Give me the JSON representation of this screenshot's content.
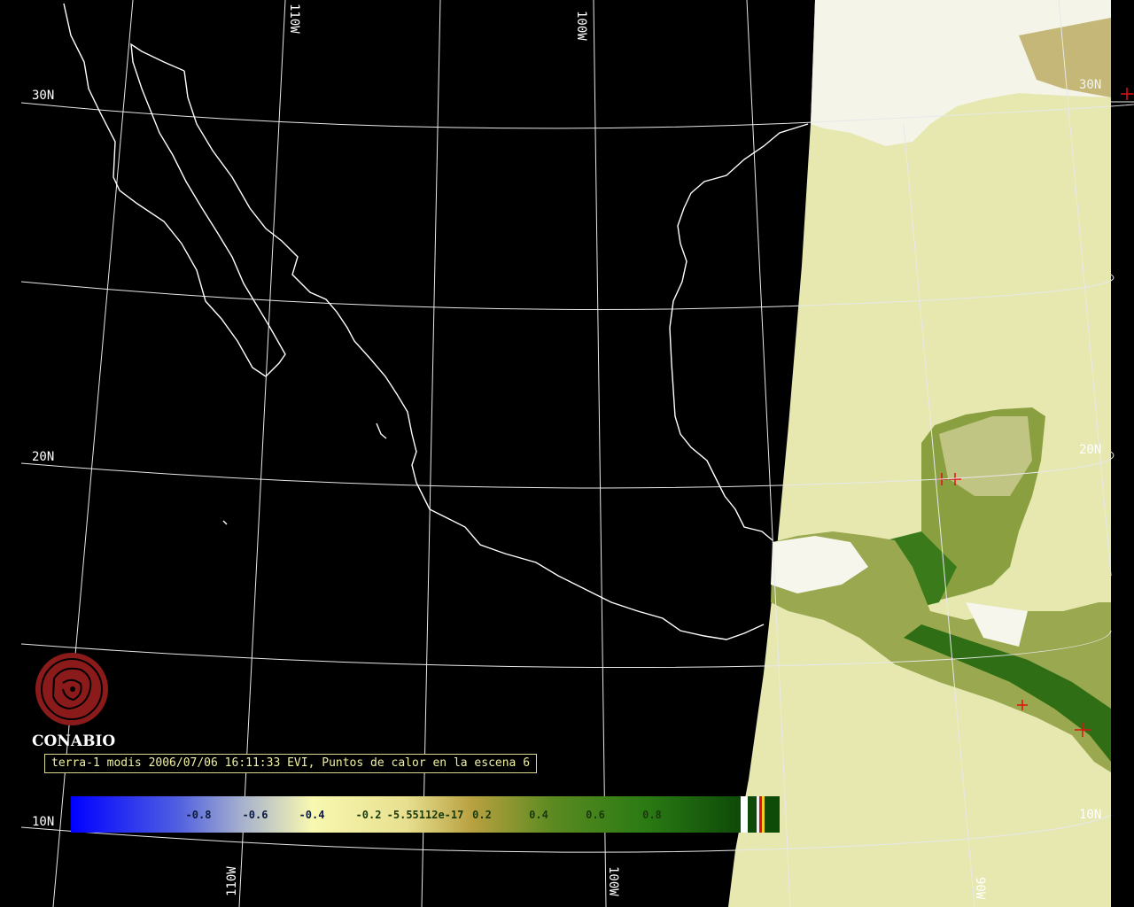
{
  "map": {
    "grid_labels": {
      "lat_30n": "30N",
      "lat_20n_left": "20N",
      "lat_10n_left": "10N",
      "lat_20n_right": "20N",
      "lat_10n_right": "10N",
      "lat_30n_right": "30N",
      "lon_110w_top": "110W",
      "lon_100w_top": "100W",
      "lon_110w_bottom": "110W",
      "lon_100w_bottom": "100W",
      "lon_90w_bottom": "90W"
    },
    "colors": {
      "background": "#000000",
      "coastline": "#ffffff",
      "graticule": "#e8e8e8",
      "water": "#e6e8b0",
      "vegetation_dark": "#2e6e14",
      "vegetation_light": "#b8a85a",
      "cloud": "#ffffff",
      "hotspot": "#e01010"
    }
  },
  "logo": {
    "name": "CONABIO",
    "color": "#8b1a1a"
  },
  "caption": {
    "text": "terra-1 modis 2006/07/06 16:11:33 EVI, Puntos de calor en la escena 6"
  },
  "colorbar": {
    "ticks": [
      "-0.8",
      "-0.6",
      "-0.4",
      "-0.2",
      "-5.55112e-17",
      "0.2",
      "0.4",
      "0.6",
      "0.8"
    ],
    "tick_values": [
      -0.8,
      -0.6,
      -0.4,
      -0.2,
      0.0,
      0.2,
      0.4,
      0.6,
      0.8
    ],
    "range": [
      -1.0,
      1.0
    ],
    "colors": [
      "#0000ff",
      "#aab4cc",
      "#f8f8b0",
      "#b8a040",
      "#2a8a14",
      "#0e4a08"
    ]
  }
}
